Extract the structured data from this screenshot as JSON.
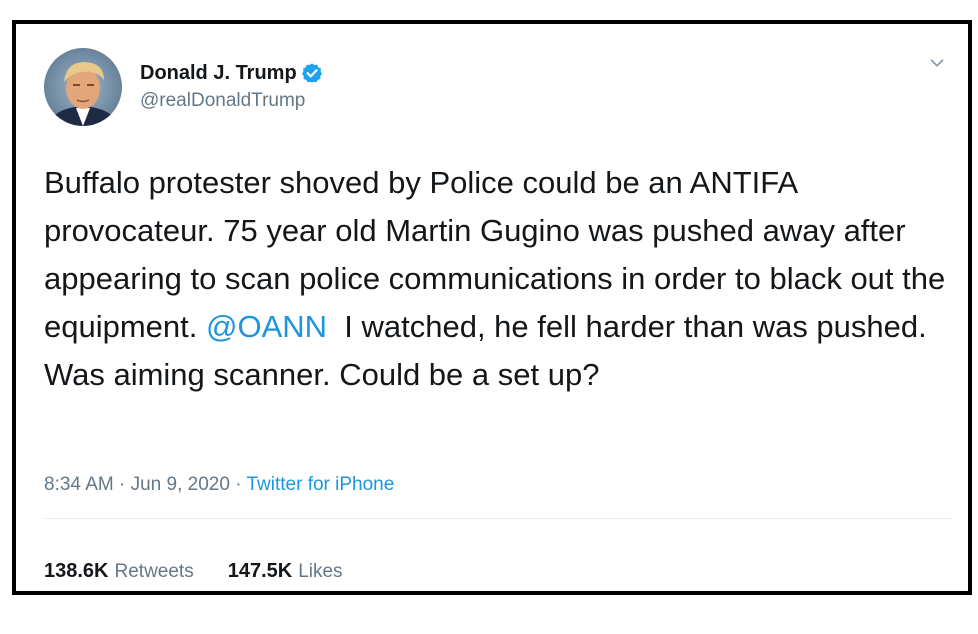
{
  "tweet": {
    "author": {
      "display_name": "Donald J. Trump",
      "handle": "@realDonaldTrump",
      "verified": true
    },
    "text": {
      "part1": "Buffalo protester shoved by Police could be an ANTIFA provocateur. 75 year old Martin Gugino was pushed away after appearing to scan police communications in order to black out the equipment. ",
      "mention": "@OANN",
      "part2": "  I watched, he fell harder than was pushed. Was aiming scanner. Could be a set up?"
    },
    "meta": {
      "time": "8:34 AM",
      "separator1": " · ",
      "date": "Jun 9, 2020",
      "separator2": " · ",
      "source": "Twitter for iPhone"
    },
    "stats": {
      "retweets_count": "138.6K",
      "retweets_label": "Retweets",
      "likes_count": "147.5K",
      "likes_label": "Likes"
    }
  },
  "colors": {
    "text": "#14171a",
    "secondary": "#657786",
    "link": "#1b95e0",
    "verified": "#1da1f2",
    "border": "#000000"
  },
  "icons": {
    "verified": "verified-badge-icon",
    "chevron": "chevron-down-icon"
  }
}
